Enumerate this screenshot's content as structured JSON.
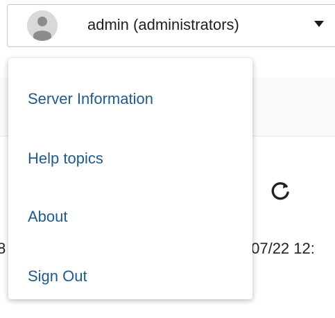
{
  "user_menu": {
    "label": "admin (administrators)",
    "avatar_icon": "user-avatar-icon",
    "caret_icon": "caret-down-icon"
  },
  "dropdown": {
    "items": [
      {
        "label": "Server Information"
      },
      {
        "label": "Help topics"
      },
      {
        "label": "About"
      },
      {
        "label": "Sign Out"
      }
    ]
  },
  "background": {
    "refresh_icon": "refresh-icon",
    "left_partial_text": "8",
    "date_partial_text": "/07/22 12:"
  },
  "colors": {
    "menu_text": "#1f5a8c",
    "avatar_bg": "#d9d9d9",
    "avatar_fg": "#8c8c8c"
  }
}
